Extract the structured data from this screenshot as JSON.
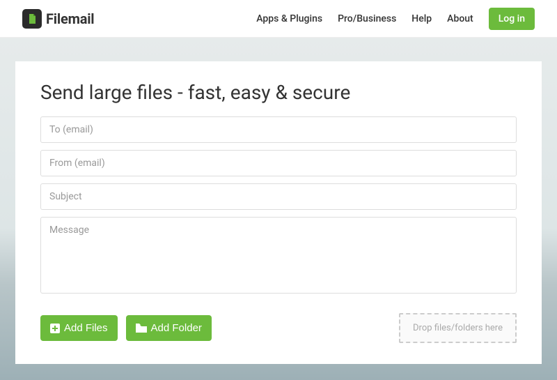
{
  "brand": {
    "name": "Filemail"
  },
  "nav": {
    "items": [
      {
        "label": "Apps & Plugins"
      },
      {
        "label": "Pro/Business"
      },
      {
        "label": "Help"
      },
      {
        "label": "About"
      }
    ],
    "login_label": "Log in"
  },
  "form": {
    "heading": "Send large files - fast, easy & secure",
    "to_placeholder": "To (email)",
    "from_placeholder": "From (email)",
    "subject_placeholder": "Subject",
    "message_placeholder": "Message",
    "add_files_label": "Add Files",
    "add_folder_label": "Add Folder",
    "dropzone_label": "Drop files/folders here"
  },
  "colors": {
    "accent": "#6cbb3c"
  }
}
